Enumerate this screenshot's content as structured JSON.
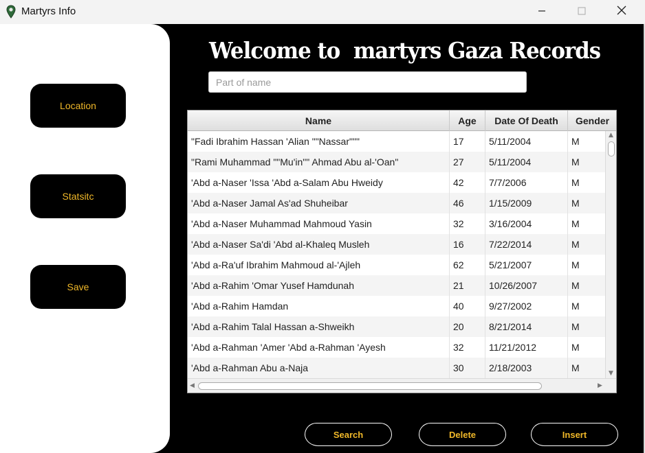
{
  "window": {
    "title": "Martyrs Info",
    "icon": "map-pin-icon",
    "controls": [
      "minimize-icon",
      "maximize-icon",
      "close-icon"
    ]
  },
  "colors": {
    "background": "#000000",
    "sidebar": "#ffffff",
    "accent": "#f0b829",
    "heading": "#ffffff"
  },
  "sidebar": {
    "location_label": "Location",
    "statistic_label": "Statsitc",
    "save_label": "Save"
  },
  "header": {
    "welcome": "Welcome to  martyrs Gaza Records"
  },
  "search": {
    "value": "",
    "placeholder": "Part of name"
  },
  "table": {
    "columns": [
      "Name",
      "Age",
      "Date Of Death",
      "Gender"
    ],
    "rows": [
      [
        "\"Fadi Ibrahim Hassan 'Alian \"\"Nassar\"\"\"",
        "17",
        "5/11/2004",
        "M"
      ],
      [
        "\"Rami Muhammad \"\"Mu'in\"\" Ahmad Abu al-'Oan\"",
        "27",
        "5/11/2004",
        "M"
      ],
      [
        "'Abd a-Naser 'Issa 'Abd a-Salam Abu Hweidy",
        "42",
        "7/7/2006",
        "M"
      ],
      [
        "'Abd a-Naser Jamal As'ad Shuheibar",
        "46",
        "1/15/2009",
        "M"
      ],
      [
        "'Abd a-Naser Muhammad Mahmoud Yasin",
        "32",
        "3/16/2004",
        "M"
      ],
      [
        "'Abd a-Naser Sa'di 'Abd al-Khaleq Musleh",
        "16",
        "7/22/2014",
        "M"
      ],
      [
        "'Abd a-Ra'uf Ibrahim Mahmoud al-'Ajleh",
        "62",
        "5/21/2007",
        "M"
      ],
      [
        "'Abd a-Rahim 'Omar Yusef Hamdunah",
        "21",
        "10/26/2007",
        "M"
      ],
      [
        "'Abd a-Rahim Hamdan",
        "40",
        "9/27/2002",
        "M"
      ],
      [
        "'Abd a-Rahim Talal Hassan a-Shweikh",
        "20",
        "8/21/2014",
        "M"
      ],
      [
        "'Abd a-Rahman 'Amer 'Abd a-Rahman 'Ayesh",
        "32",
        "11/21/2012",
        "M"
      ],
      [
        "'Abd a-Rahman Abu a-Naja",
        "30",
        "2/18/2003",
        "M"
      ]
    ]
  },
  "actions": {
    "search_label": "Search",
    "delete_label": "Delete",
    "insert_label": "Insert"
  }
}
